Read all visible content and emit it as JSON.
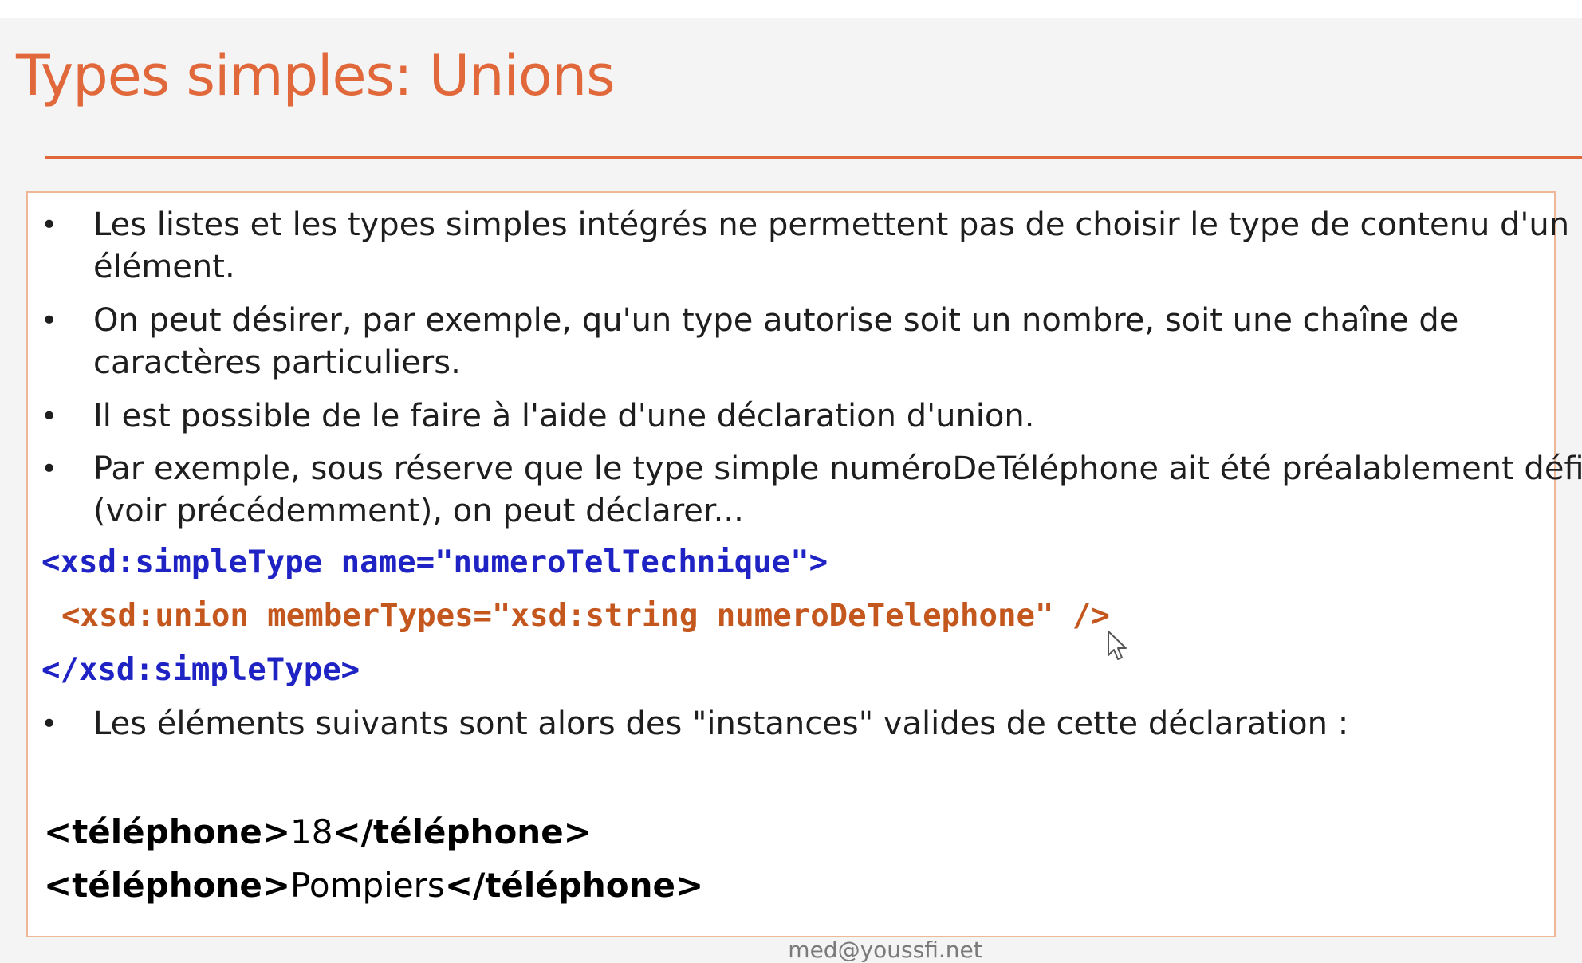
{
  "slide": {
    "title": "Types simples: Unions",
    "bullets": [
      {
        "line1": "Les listes et les types simples intégrés ne permettent pas de choisir le type de contenu d'un",
        "line2": "élément."
      },
      {
        "line1": "On peut désirer, par exemple, qu'un type autorise soit un nombre, soit une chaîne de",
        "line2": "caractères particuliers."
      },
      {
        "line1": "Il est possible de le faire à l'aide d'une déclaration d'union."
      },
      {
        "line1": "Par exemple, sous réserve que le type simple numéroDeTéléphone ait été préalablement défini",
        "line2": "(voir précédemment), on peut déclarer..."
      },
      {
        "line1": "Les éléments suivants sont alors des \"instances\" valides de cette déclaration :"
      }
    ],
    "code": {
      "open": "<xsd:simpleType name=\"numeroTelTechnique\">",
      "union": "<xsd:union memberTypes=\"xsd:string numeroDeTelephone\" />",
      "close": "</xsd:simpleType>"
    },
    "examples": [
      {
        "open_tag": "<téléphone>",
        "value": "18",
        "close_tag": "</téléphone>"
      },
      {
        "open_tag": "<téléphone>",
        "value": "Pompiers",
        "close_tag": "</téléphone>"
      }
    ],
    "footer": "med@youssfi.net"
  },
  "colors": {
    "accent": "#e0683a",
    "code_blue": "#1f23c4",
    "code_orange": "#c4571e",
    "box_border": "#f0b796"
  },
  "icons": {
    "cursor": "mouse-pointer-icon"
  }
}
